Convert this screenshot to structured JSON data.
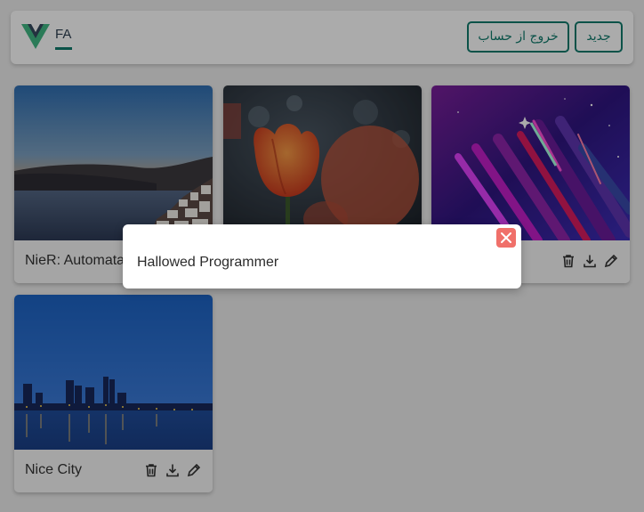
{
  "header": {
    "language_tab": "FA",
    "new_button": "جدید",
    "logout_button": "خروج از حساب",
    "logo_colors": {
      "outer": "#41b883",
      "inner": "#35495e"
    },
    "accent": "#0f7b6c"
  },
  "cards": [
    {
      "title": "NieR: Automata",
      "image": "sunset-coast-photo"
    },
    {
      "title": "",
      "image": "orange-tulips-photo"
    },
    {
      "title": "",
      "image": "neon-abstract-photo"
    },
    {
      "title": "Nice City",
      "image": "night-city-skyline-photo"
    }
  ],
  "card_actions": [
    "trash-icon",
    "download-icon",
    "pencil-icon"
  ],
  "dialog": {
    "message": "Hallowed Programmer",
    "close_icon": "close-icon",
    "close_color": "#f0706a"
  }
}
